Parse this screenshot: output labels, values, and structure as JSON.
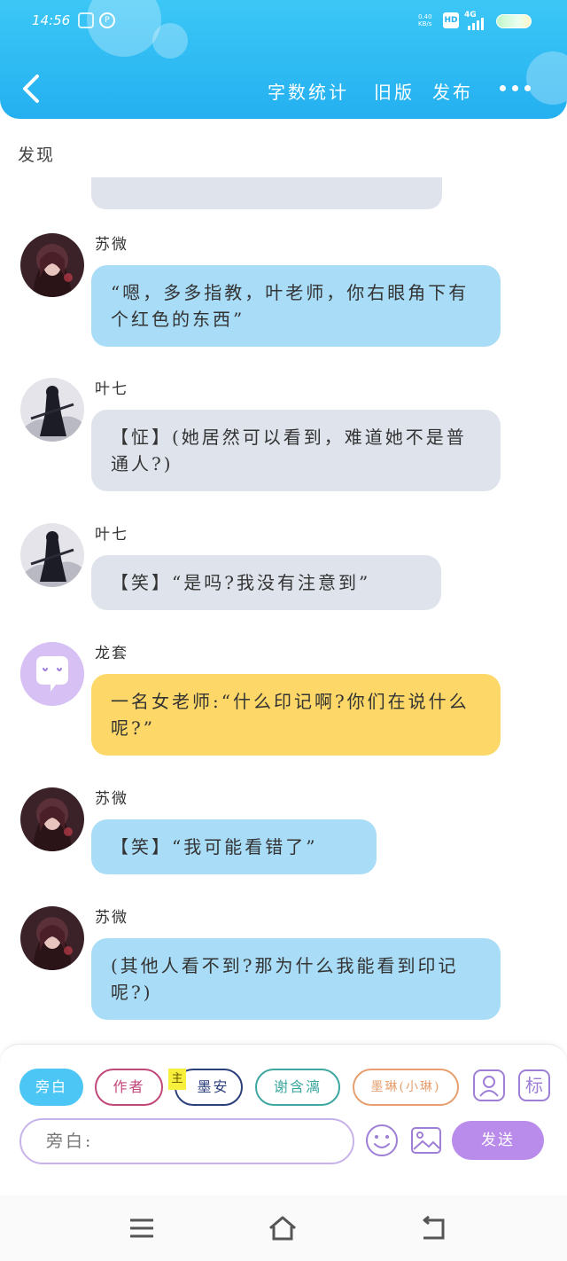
{
  "status_bar": {
    "time": "14:56",
    "net_speed_value": "0.40",
    "net_speed_unit": "KB/s",
    "hd": "HD",
    "signal": "4G"
  },
  "header": {
    "actions": [
      "字数统计",
      "旧版",
      "发布"
    ],
    "back_icon": "chevron-left-icon",
    "more_icon": "more-dots-icon"
  },
  "section_title": "发现",
  "messages": [
    {
      "sender": "苏微",
      "text": "“嗯，多多指教，叶老师，你右眼角下有个红色的东西”",
      "style": "blue",
      "avatar": "girl-avatar"
    },
    {
      "sender": "叶七",
      "text": "【怔】(她居然可以看到，难道她不是普通人?)",
      "style": "gray",
      "avatar": "dark-figure-avatar"
    },
    {
      "sender": "叶七",
      "text": "【笑】“是吗?我没有注意到”",
      "style": "gray",
      "avatar": "dark-figure-avatar"
    },
    {
      "sender": "龙套",
      "text": "一名女老师:“什么印记啊?你们在说什么呢?”",
      "style": "yellow",
      "avatar": "chat-bubble-avatar"
    },
    {
      "sender": "苏微",
      "text": "【笑】“我可能看错了”",
      "style": "blue",
      "avatar": "girl-avatar"
    },
    {
      "sender": "苏微",
      "text": "(其他人看不到?那为什么我能看到印记呢?)",
      "style": "blue",
      "avatar": "girl-avatar"
    }
  ],
  "role_chips": [
    {
      "label": "旁白",
      "active": true
    },
    {
      "label": "作者",
      "active": false
    },
    {
      "label": "墨安",
      "active": false,
      "tag": "主"
    },
    {
      "label": "谢含漓",
      "active": false
    },
    {
      "label": "墨琳(小琳)",
      "active": false
    }
  ],
  "input": {
    "placeholder": "旁白:"
  },
  "send_label": "发送",
  "tag_button_label": "标",
  "colors": {
    "header": "#24b0f0",
    "bubble_blue": "#a9dcf7",
    "bubble_gray": "#dfe4ec",
    "bubble_yellow": "#fdd868",
    "accent_purple": "#b98bea"
  }
}
